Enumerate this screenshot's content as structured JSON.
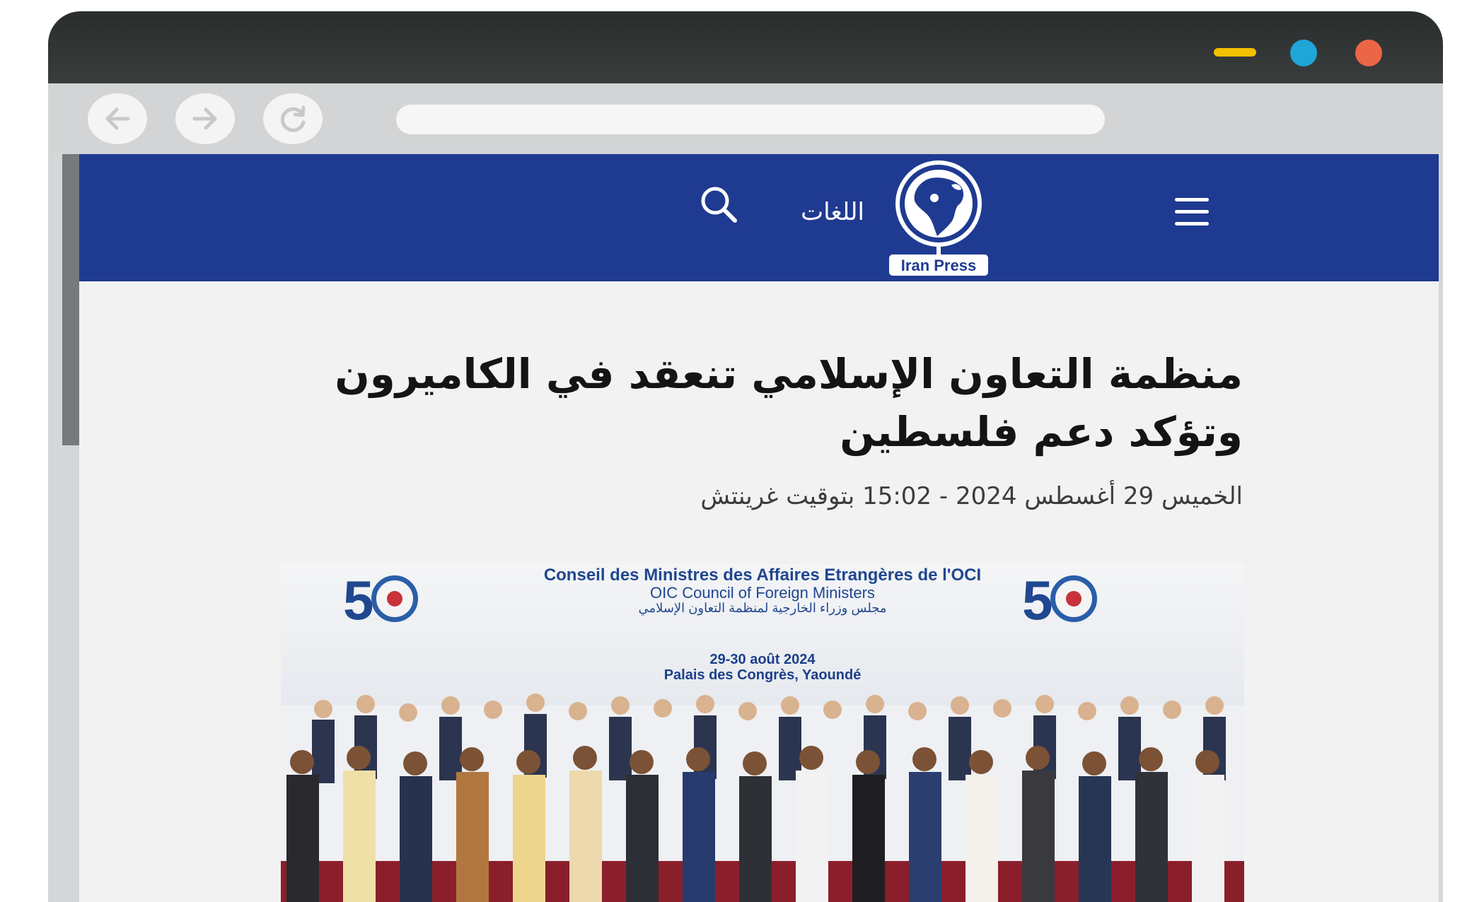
{
  "browser": {
    "window_controls": {
      "close_color": "#ea6646",
      "maximize_color": "#1fa5d8",
      "minimize_color": "#f2c200"
    },
    "nav": {
      "back_icon": "arrow-left-icon",
      "forward_icon": "arrow-right-icon",
      "reload_icon": "reload-icon"
    },
    "address_bar_value": ""
  },
  "site": {
    "header_bg": "#1f3a91",
    "logo_text": "Iran Press",
    "languages_label": "اللغات",
    "menu_icon": "hamburger-menu-icon",
    "search_icon": "search-icon"
  },
  "article": {
    "title": "منظمة التعاون الإسلامي تنعقد في الكاميرون وتؤكد دعم فلسطين",
    "date": "الخميس 29 أغسطس 2024 - 15:02 بتوقيت غرينتش"
  },
  "photo": {
    "banner_line_1": "Conseil des Ministres des Affaires Etrangères de l'OCI",
    "banner_line_2": "OIC Council of Foreign Ministers",
    "banner_line_3": "مجلس وزراء الخارجية لمنظمة التعاون الإسلامي",
    "banner_dates": "29-30 août 2024",
    "banner_venue": "Palais des Congrès, Yaoundé",
    "emblem_number": "50"
  }
}
